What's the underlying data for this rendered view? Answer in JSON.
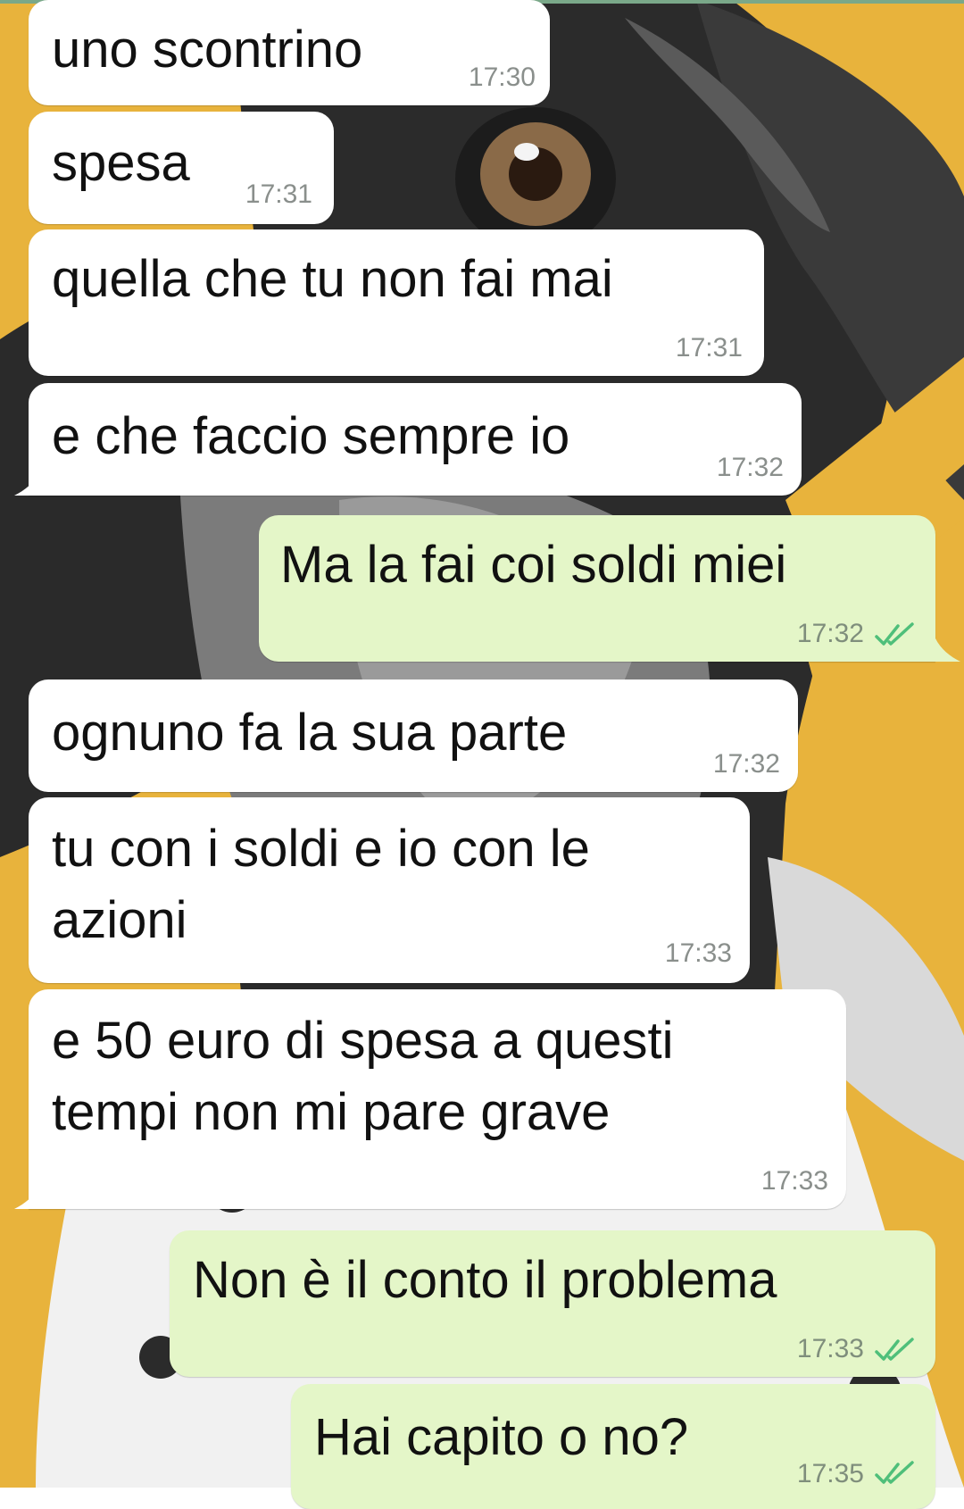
{
  "colors": {
    "incoming_bubble": "#ffffff",
    "outgoing_bubble": "#e4f6c8",
    "read_ticks": "#4fbf7a",
    "wallpaper_yellow": "#e8b33c"
  },
  "wallpaper": {
    "description_icon": "dog-portrait-wallpaper"
  },
  "messages": [
    {
      "direction": "incoming",
      "text": "uno scontrino",
      "time": "17:30"
    },
    {
      "direction": "incoming",
      "text": "spesa",
      "time": "17:31"
    },
    {
      "direction": "incoming",
      "text": "quella che tu non fai mai",
      "time": "17:31"
    },
    {
      "direction": "incoming",
      "text": "e che faccio sempre io",
      "time": "17:32"
    },
    {
      "direction": "outgoing",
      "text": "Ma la fai coi soldi miei",
      "time": "17:32",
      "status_icon": "double-check-read-icon"
    },
    {
      "direction": "incoming",
      "text": "ognuno fa la sua parte",
      "time": "17:32"
    },
    {
      "direction": "incoming",
      "text_lines": [
        "tu con i soldi e io con le",
        "azioni"
      ],
      "time": "17:33"
    },
    {
      "direction": "incoming",
      "text_lines": [
        "e 50 euro di spesa a questi",
        "tempi non mi pare grave"
      ],
      "time": "17:33"
    },
    {
      "direction": "outgoing",
      "text": "Non è il conto il problema",
      "time": "17:33",
      "status_icon": "double-check-read-icon"
    },
    {
      "direction": "outgoing",
      "text": "Hai capito o no?",
      "time": "17:35",
      "status_icon": "double-check-read-icon"
    }
  ]
}
